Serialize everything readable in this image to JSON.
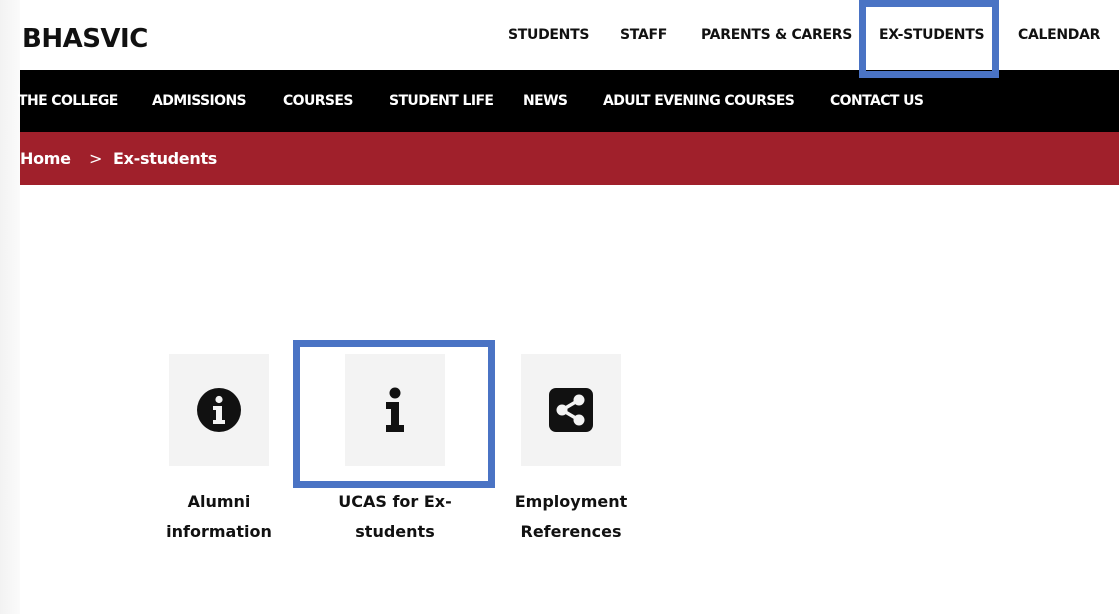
{
  "header": {
    "logo": "BHASVIC",
    "top_nav": [
      {
        "label": "STUDENTS"
      },
      {
        "label": "STAFF"
      },
      {
        "label": "PARENTS & CARERS"
      },
      {
        "label": "EX-STUDENTS"
      },
      {
        "label": "CALENDAR"
      }
    ]
  },
  "main_nav": [
    {
      "label": "THE COLLEGE"
    },
    {
      "label": "ADMISSIONS"
    },
    {
      "label": "COURSES"
    },
    {
      "label": "STUDENT LIFE"
    },
    {
      "label": "NEWS"
    },
    {
      "label": "ADULT EVENING COURSES"
    },
    {
      "label": "CONTACT US"
    }
  ],
  "breadcrumb": {
    "home": "Home",
    "separator": ">",
    "current": "Ex-students"
  },
  "tiles": [
    {
      "icon": "info-circle-icon",
      "line1": "Alumni",
      "line2": "information"
    },
    {
      "icon": "info-icon",
      "line1": "UCAS for Ex-",
      "line2": "students"
    },
    {
      "icon": "share-icon",
      "line1": "Employment",
      "line2": "References"
    }
  ],
  "colors": {
    "nav_bg": "#000000",
    "breadcrumb_bg": "#a0202b",
    "highlight": "#4a73c4",
    "tile_bg": "#f3f3f3"
  }
}
